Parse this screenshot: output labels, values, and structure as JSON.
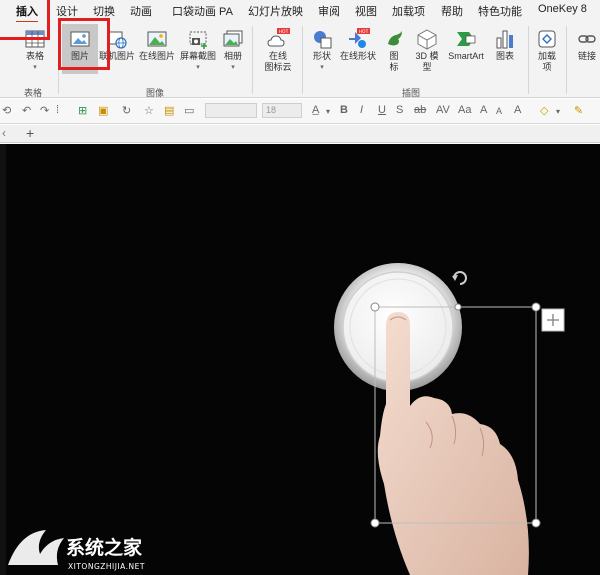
{
  "tabs": [
    "插入",
    "设计",
    "切换",
    "动画",
    "口袋动画 PA",
    "幻灯片放映",
    "审阅",
    "视图",
    "加载项",
    "帮助",
    "特色功能",
    "OneKey 8"
  ],
  "ribbon": {
    "table": {
      "label": "表格",
      "group": "表格"
    },
    "image_group": "图像",
    "picture": "图片",
    "online_picture_linked": "联机图片",
    "online_picture": "在线图片",
    "screenshot": "屏幕截图",
    "album": "相册",
    "online_icon_line1": "在线",
    "online_icon_line2": "图标云",
    "shapes": "形状",
    "online_shapes": "在线形状",
    "icons_label": "图",
    "icons_label2": "标",
    "model3d": "3D 模",
    "model3d2": "型",
    "smartart": "SmartArt",
    "chart": "图表",
    "illustration_group": "插图",
    "addins": "加载",
    "addins2": "项",
    "link": "链接",
    "hot_badge": "HOT"
  },
  "toolbar2": {
    "font_size": "18"
  },
  "colors": {
    "accent": "#c43e1c",
    "highlight_red": "#e02020",
    "canvas_bg": "#050505"
  },
  "watermark": {
    "cn": "系统之家",
    "en": "XITONGZHIJIA.NET"
  }
}
